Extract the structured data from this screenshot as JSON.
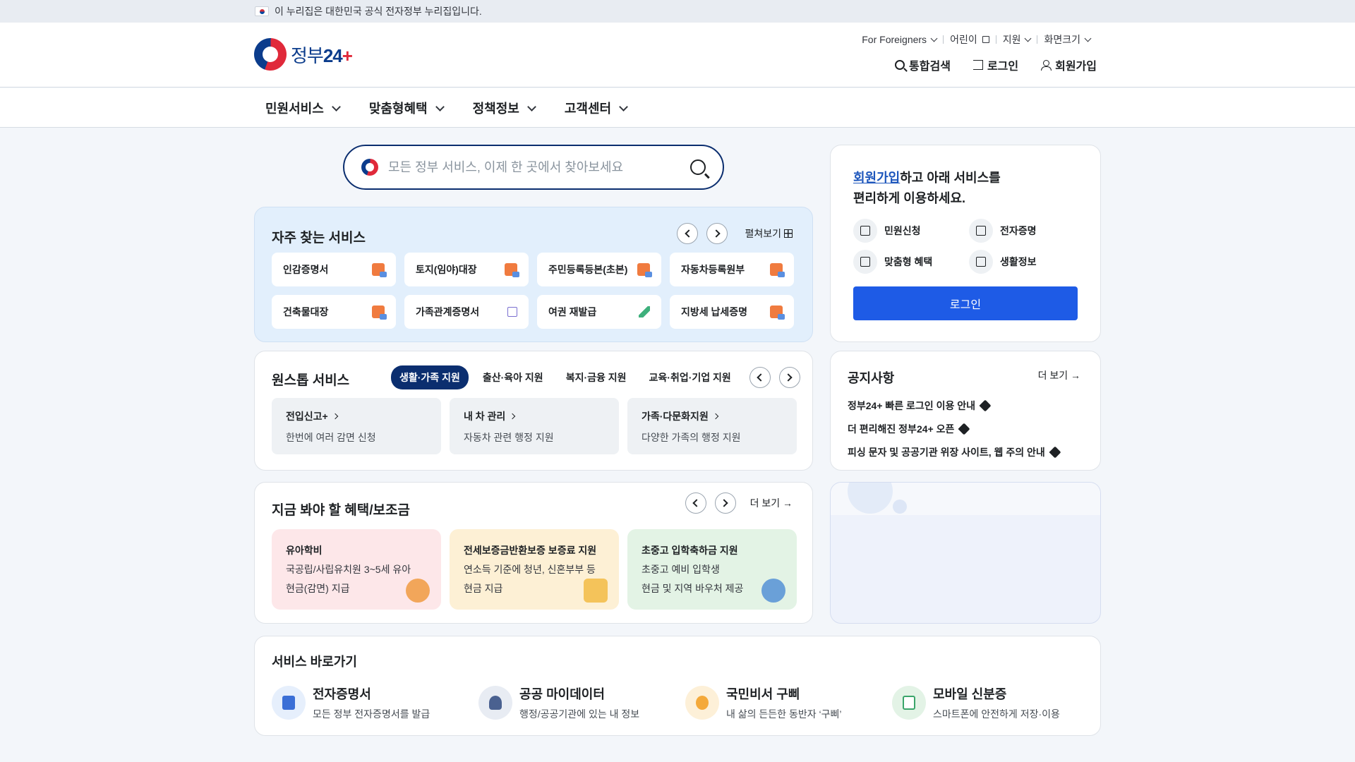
{
  "banner": {
    "text": "이 누리집은 대한민국 공식 전자정부 누리집입니다."
  },
  "logo": {
    "text": "정부",
    "number": "24",
    "plus": "+"
  },
  "util": {
    "foreigners": "For Foreigners",
    "kids": "어린이",
    "support": "지원",
    "screen": "화면크기"
  },
  "actions": {
    "search": "통합검색",
    "login": "로그인",
    "signup": "회원가입"
  },
  "gnb": {
    "m1": "민원서비스",
    "m2": "맞춤형혜택",
    "m3": "정책정보",
    "m4": "고객센터"
  },
  "search": {
    "placeholder": "모든 정부 서비스, 이제 한 곳에서 찾아보세요"
  },
  "frequent": {
    "title": "자주 찾는 서비스",
    "expand": "펼쳐보기",
    "items": [
      "인감증명서",
      "토지(임야)대장",
      "주민등록등본(초본)",
      "자동차등록원부",
      "건축물대장",
      "가족관계증명서",
      "여권 재발급",
      "지방세 납세증명"
    ]
  },
  "login_card": {
    "signup_link": "회원가입",
    "msg1": "하고 아래 서비스를",
    "msg2": "편리하게 이용하세요.",
    "s1": "민원신청",
    "s2": "전자증명",
    "s3": "맞춤형 혜택",
    "s4": "생활정보",
    "button": "로그인"
  },
  "onestop": {
    "title": "원스톱 서비스",
    "tabs": [
      "생활·가족 지원",
      "출산·육아 지원",
      "복지·금융 지원",
      "교육·취업·기업 지원"
    ],
    "items": [
      {
        "t": "전입신고+",
        "d": "한번에 여러 감면 신청"
      },
      {
        "t": "내 차 관리",
        "d": "자동차 관련 행정 지원"
      },
      {
        "t": "가족·다문화지원",
        "d": "다양한 가족의 행정 지원"
      }
    ]
  },
  "notice": {
    "title": "공지사항",
    "more": "더 보기 →",
    "items": [
      "정부24+ 빠른 로그인 이용 안내",
      "더 편리해진 정부24+ 오픈",
      "피싱 문자 및 공공기관 위장 사이트, 웹 주의 안내"
    ]
  },
  "benefit": {
    "title": "지금 봐야 할 혜택/보조금",
    "more": "더 보기 →",
    "items": [
      {
        "t": "유아학비",
        "d1": "국공립/사립유치원 3~5세 유아",
        "d2": "현금(감면) 지급"
      },
      {
        "t": "전세보증금반환보증 보증료 지원",
        "d1": "연소득 기준에 청년, 신혼부부 등",
        "d2": "현금 지급"
      },
      {
        "t": "초중고 입학축하금 지원",
        "d1": "초중고 예비 입학생",
        "d2": "현금 및 지역 바우처 제공"
      }
    ]
  },
  "shortcut": {
    "title": "서비스 바로가기",
    "items": [
      {
        "t": "전자증명서",
        "d": "모든 정부 전자증명서를 발급"
      },
      {
        "t": "공공 마이데이터",
        "d": "행정/공공기관에 있는 내 정보"
      },
      {
        "t": "국민비서 구삐",
        "d": "내 삶의 든든한 동반자 ‘구삐’"
      },
      {
        "t": "모바일 신분증",
        "d": "스마트폰에 안전하게 저장·이용"
      }
    ]
  },
  "colors": {
    "primary": "#1e5be6",
    "navy": "#0b2e6f",
    "freq_bg": "#e2effc"
  }
}
